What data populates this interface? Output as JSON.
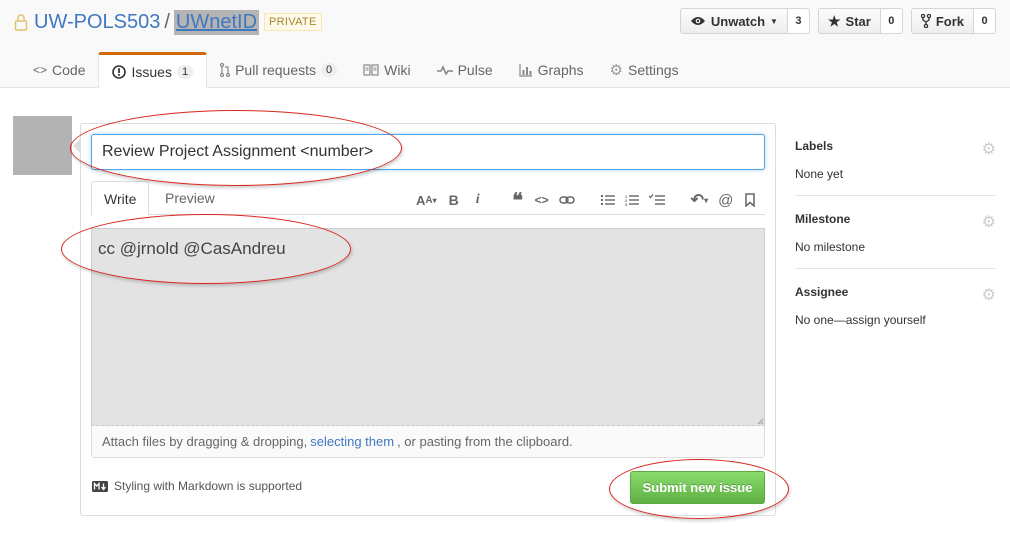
{
  "repo": {
    "owner": "UW-POLS503",
    "separator": "/",
    "name": "UWnetID",
    "visibility": "PRIVATE"
  },
  "actions": {
    "watch_label": "Unwatch",
    "watch_count": "3",
    "star_label": "Star",
    "star_count": "0",
    "fork_label": "Fork",
    "fork_count": "0"
  },
  "nav": {
    "code": "Code",
    "issues": "Issues",
    "issues_count": "1",
    "pull_requests": "Pull requests",
    "pull_requests_count": "0",
    "wiki": "Wiki",
    "pulse": "Pulse",
    "graphs": "Graphs",
    "settings": "Settings"
  },
  "form": {
    "title_value": "Review Project Assignment <number>",
    "tab_write": "Write",
    "tab_preview": "Preview",
    "body_value": "cc @jrnold @CasAndreu",
    "attach_prefix": "Attach files by dragging & dropping,",
    "attach_link": "selecting them",
    "attach_suffix": ", or pasting from the clipboard.",
    "markdown_note": "Styling with Markdown is supported",
    "submit_label": "Submit new issue",
    "toolbar_icons": [
      "text-size-icon",
      "bold-icon",
      "italic-icon",
      "quote-icon",
      "code-icon",
      "link-icon",
      "unordered-list-icon",
      "ordered-list-icon",
      "task-list-icon",
      "reply-icon",
      "mention-icon",
      "bookmark-icon"
    ]
  },
  "sidebar": {
    "labels_heading": "Labels",
    "labels_value": "None yet",
    "milestone_heading": "Milestone",
    "milestone_value": "No milestone",
    "assignee_heading": "Assignee",
    "assignee_value": "No one—assign yourself"
  },
  "colors": {
    "link": "#4078c0",
    "submit_green": "#60b044",
    "selected_tab_accent": "#d26911",
    "annotation_red": "#d9271d"
  }
}
